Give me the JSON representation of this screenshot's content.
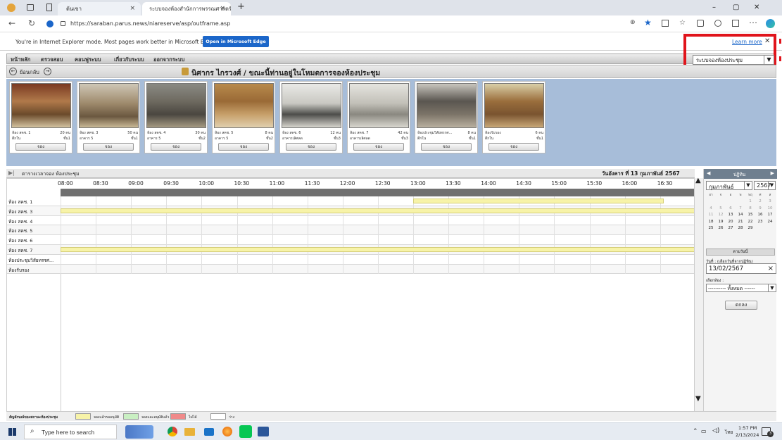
{
  "browser": {
    "tabs": [
      {
        "title": "ต้นเขา",
        "close": "×"
      },
      {
        "title": "ระบบจองห้องสำนักการพรรณศาสตร์",
        "close": "×"
      }
    ],
    "new_tab": "+",
    "url": "https://saraban.parus.news/niareserve/asp/outframe.asp",
    "window_controls": {
      "minimize": "–",
      "restore": "▢",
      "close": "✕"
    }
  },
  "ie_bar": {
    "message": "You're in Internet Explorer mode. Most pages work better in Microsoft Edge.",
    "button": "Open in Microsoft Edge",
    "learn_more": "Learn more",
    "close": "✕"
  },
  "app": {
    "menu": [
      "หน้าหลัก",
      "ตรวจสอบ",
      "คอนฟูระบบ",
      "เกี่ยวกับระบบ",
      "ออกจากระบบ"
    ],
    "system_select": "ระบบจองห้องประชุม",
    "back_label": "ย้อนกลับ",
    "user_title": "นิศากร ไกรวงศ์ / ขณะนี้ท่านอยู่ในโหมดการจองห้องประชุม",
    "rooms": [
      {
        "name": "ห้อง สคช. 1",
        "capacity": "20 คน",
        "building": "ตึกใน",
        "floor": "ชั้น1",
        "button": "จอง"
      },
      {
        "name": "ห้อง สคช. 3",
        "capacity": "50 คน",
        "building": "อาคาร 5",
        "floor": "ชั้น1",
        "button": "จอง"
      },
      {
        "name": "ห้อง สคช. 4",
        "capacity": "30 คน",
        "building": "อาคาร 5",
        "floor": "ชั้น2",
        "button": "จอง"
      },
      {
        "name": "ห้อง สคช. 5",
        "capacity": "8 คน",
        "building": "อาคาร 5",
        "floor": "ชั้น2",
        "button": "จอง"
      },
      {
        "name": "ห้อง สคช. 6",
        "capacity": "12 คน",
        "building": "อาคารเลิศลด",
        "floor": "ชั้น3",
        "button": "จอง"
      },
      {
        "name": "ห้อง สคช. 7",
        "capacity": "42 คน",
        "building": "อาคารเลิศลด",
        "floor": "ชั้น3",
        "button": "จอง"
      },
      {
        "name": "ห้องประชุมวิสัยทรรศ...",
        "capacity": "8 คน",
        "building": "ตึกใน",
        "floor": "ชั้น1",
        "button": "จอง"
      },
      {
        "name": "ห้องรับรอง",
        "capacity": "6 คน",
        "building": "ตึกใน",
        "floor": "ชั้น1",
        "button": "จอง"
      }
    ],
    "schedule": {
      "heading": "ตารางเวลาจอง ห้องประชุม",
      "date_label": "วันอังคาร ที่ 13 กุมภาพันธ์ 2567",
      "times": [
        "08:00",
        "08:30",
        "09:00",
        "09:30",
        "10:00",
        "10:30",
        "11:00",
        "11:30",
        "12:00",
        "12:30",
        "13:00",
        "13:30",
        "14:00",
        "14:30",
        "15:00",
        "15:30",
        "16:00",
        "16:30"
      ],
      "rows": [
        "ห้อง สคช. 1",
        "ห้อง สคช. 3",
        "ห้อง สคช. 4",
        "ห้อง สคช. 5",
        "ห้อง สคช. 6",
        "ห้อง สคช. 7",
        "ห้องประชุมวิสัยทรรศ...",
        "ห้องรับรอง"
      ]
    },
    "legend": {
      "title": "สัญลักษณ์ของสถานะห้องประชุม",
      "items": [
        {
          "label": "จองแล้วรออนุมัติ",
          "color": "#f7f3a8"
        },
        {
          "label": "จองและอนุมัติแล้ว",
          "color": "#c9efc2"
        },
        {
          "label": "ไม่ได้",
          "color": "#f08a8a"
        },
        {
          "label": "ว่าง",
          "color": "#ffffff"
        }
      ]
    },
    "calendar": {
      "header": "ปฏิทิน",
      "prev": "◀",
      "next": "▶",
      "month": "กุมภาพันธ์",
      "year": "2567",
      "weekdays": [
        "อา",
        "จ",
        "อ",
        "พ",
        "พฤ",
        "ศ",
        "ส"
      ],
      "weeks": [
        [
          "",
          "",
          "",
          "",
          "1",
          "2",
          "3"
        ],
        [
          "4",
          "5",
          "6",
          "7",
          "8",
          "9",
          "10"
        ],
        [
          "11",
          "12",
          "13",
          "14",
          "15",
          "16",
          "17"
        ],
        [
          "18",
          "19",
          "20",
          "21",
          "22",
          "23",
          "24"
        ],
        [
          "25",
          "26",
          "27",
          "28",
          "29",
          "",
          ""
        ]
      ],
      "today_button": "ตามวันนี้",
      "date_label": "วันที่ : (เลือกวันที่จากปฏิทิน)",
      "date_value": "13/02/2567",
      "date_clear": "×",
      "room_label": "เลือกห้อง :",
      "room_select": "---------- ทั้งหมด ------",
      "ok_button": "ตกลง"
    }
  },
  "taskbar": {
    "search_placeholder": "Type here to search",
    "time": "1:57 PM",
    "date": "2/13/2024",
    "lang": "ไทย",
    "notif_count": "3"
  }
}
